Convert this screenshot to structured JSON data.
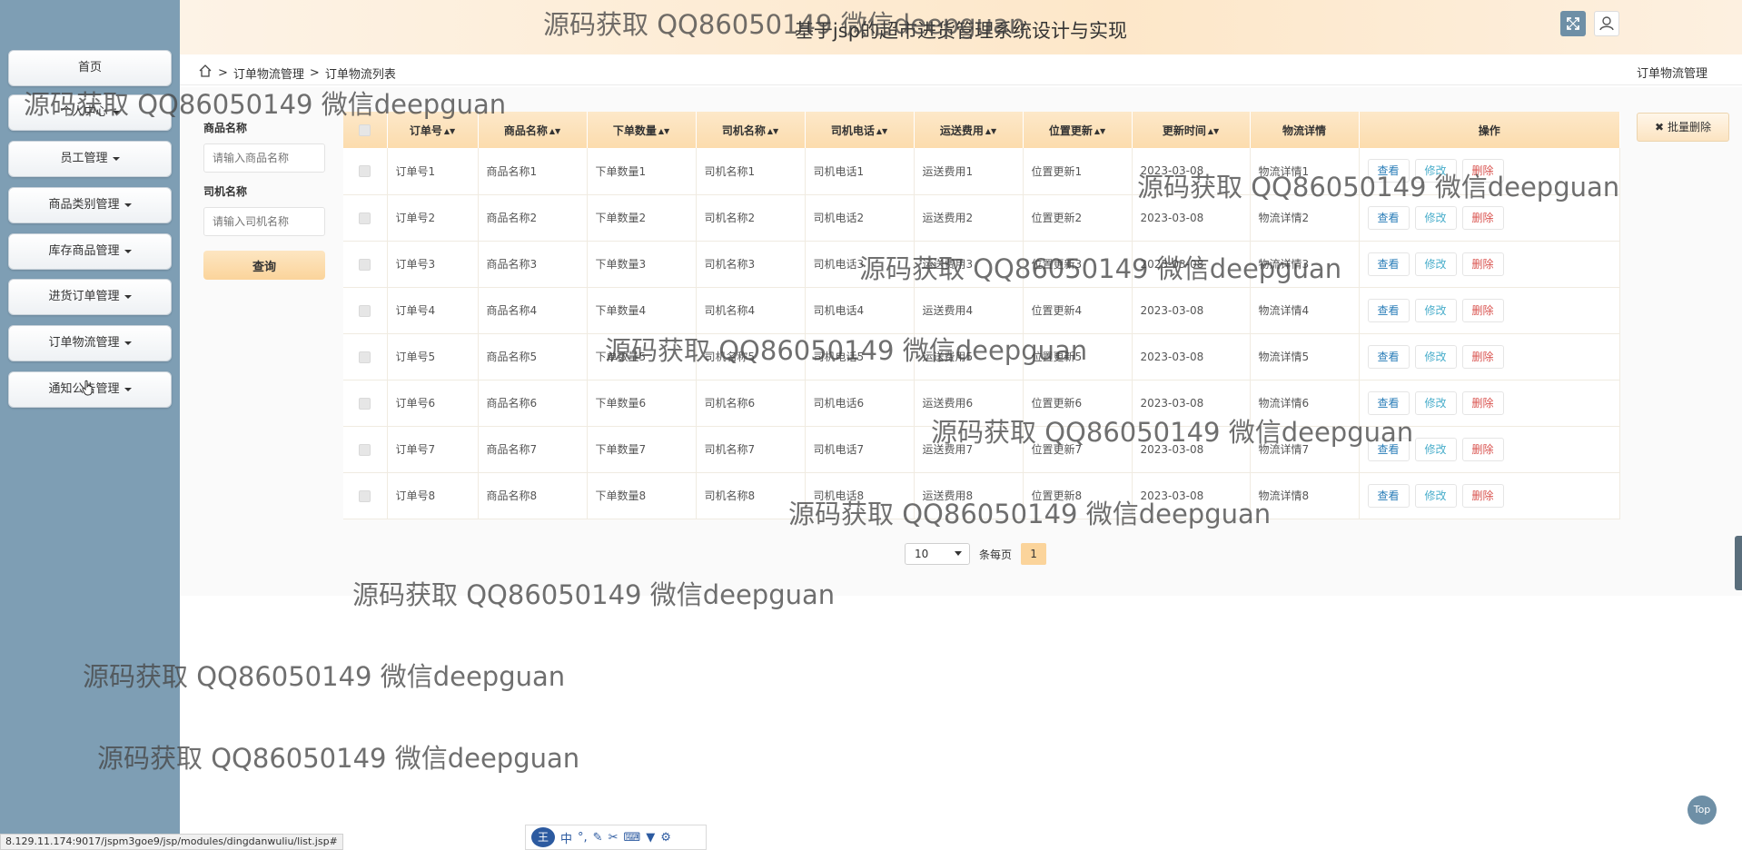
{
  "app_title": "基于jsp的超市进货管理系统设计与实现",
  "sidebar": {
    "items": [
      {
        "label": "首页",
        "dropdown": false
      },
      {
        "label": "个人中心",
        "dropdown": true
      },
      {
        "label": "员工管理",
        "dropdown": true
      },
      {
        "label": "商品类别管理",
        "dropdown": true
      },
      {
        "label": "库存商品管理",
        "dropdown": true
      },
      {
        "label": "进货订单管理",
        "dropdown": true
      },
      {
        "label": "订单物流管理",
        "dropdown": true
      },
      {
        "label": "通知公告管理",
        "dropdown": true
      }
    ]
  },
  "breadcrumb": {
    "sep": ">",
    "level1": "订单物流管理",
    "level2": "订单物流列表",
    "right_title": "订单物流管理"
  },
  "filter": {
    "product_label": "商品名称",
    "product_placeholder": "请输入商品名称",
    "driver_label": "司机名称",
    "driver_placeholder": "请输入司机名称",
    "search_button": "查询"
  },
  "batch_delete_label": "批量删除",
  "table": {
    "headers": [
      "订单号",
      "商品名称",
      "下单数量",
      "司机名称",
      "司机电话",
      "运送费用",
      "位置更新",
      "更新时间",
      "物流详情",
      "操作"
    ],
    "rows": [
      [
        "订单号1",
        "商品名称1",
        "下单数量1",
        "司机名称1",
        "司机电话1",
        "运送费用1",
        "位置更新1",
        "2023-03-08",
        "物流详情1"
      ],
      [
        "订单号2",
        "商品名称2",
        "下单数量2",
        "司机名称2",
        "司机电话2",
        "运送费用2",
        "位置更新2",
        "2023-03-08",
        "物流详情2"
      ],
      [
        "订单号3",
        "商品名称3",
        "下单数量3",
        "司机名称3",
        "司机电话3",
        "运送费用3",
        "位置更新3",
        "2023-03-08",
        "物流详情3"
      ],
      [
        "订单号4",
        "商品名称4",
        "下单数量4",
        "司机名称4",
        "司机电话4",
        "运送费用4",
        "位置更新4",
        "2023-03-08",
        "物流详情4"
      ],
      [
        "订单号5",
        "商品名称5",
        "下单数量5",
        "司机名称5",
        "司机电话5",
        "运送费用5",
        "位置更新5",
        "2023-03-08",
        "物流详情5"
      ],
      [
        "订单号6",
        "商品名称6",
        "下单数量6",
        "司机名称6",
        "司机电话6",
        "运送费用6",
        "位置更新6",
        "2023-03-08",
        "物流详情6"
      ],
      [
        "订单号7",
        "商品名称7",
        "下单数量7",
        "司机名称7",
        "司机电话7",
        "运送费用7",
        "位置更新7",
        "2023-03-08",
        "物流详情7"
      ],
      [
        "订单号8",
        "商品名称8",
        "下单数量8",
        "司机名称8",
        "司机电话8",
        "运送费用8",
        "位置更新8",
        "2023-03-08",
        "物流详情8"
      ]
    ],
    "actions": {
      "view": "查看",
      "edit": "修改",
      "delete": "删除"
    }
  },
  "pagination": {
    "page_size": "10",
    "per_page_label": "条每页",
    "current_page": "1"
  },
  "watermark_text": "源码获取 QQ86050149 微信deepguan",
  "status_url": "8.129.11.174:9017/jspm3goe9/jsp/modules/dingdanwuliu/list.jsp#",
  "ime_label": "中",
  "top_button_label": "Top",
  "colors": {
    "sidebar": "#7e9eb4",
    "header_accent": "#fbd49b",
    "view": "#2a7db8",
    "edit": "#4aaecb",
    "delete": "#d9534f"
  }
}
